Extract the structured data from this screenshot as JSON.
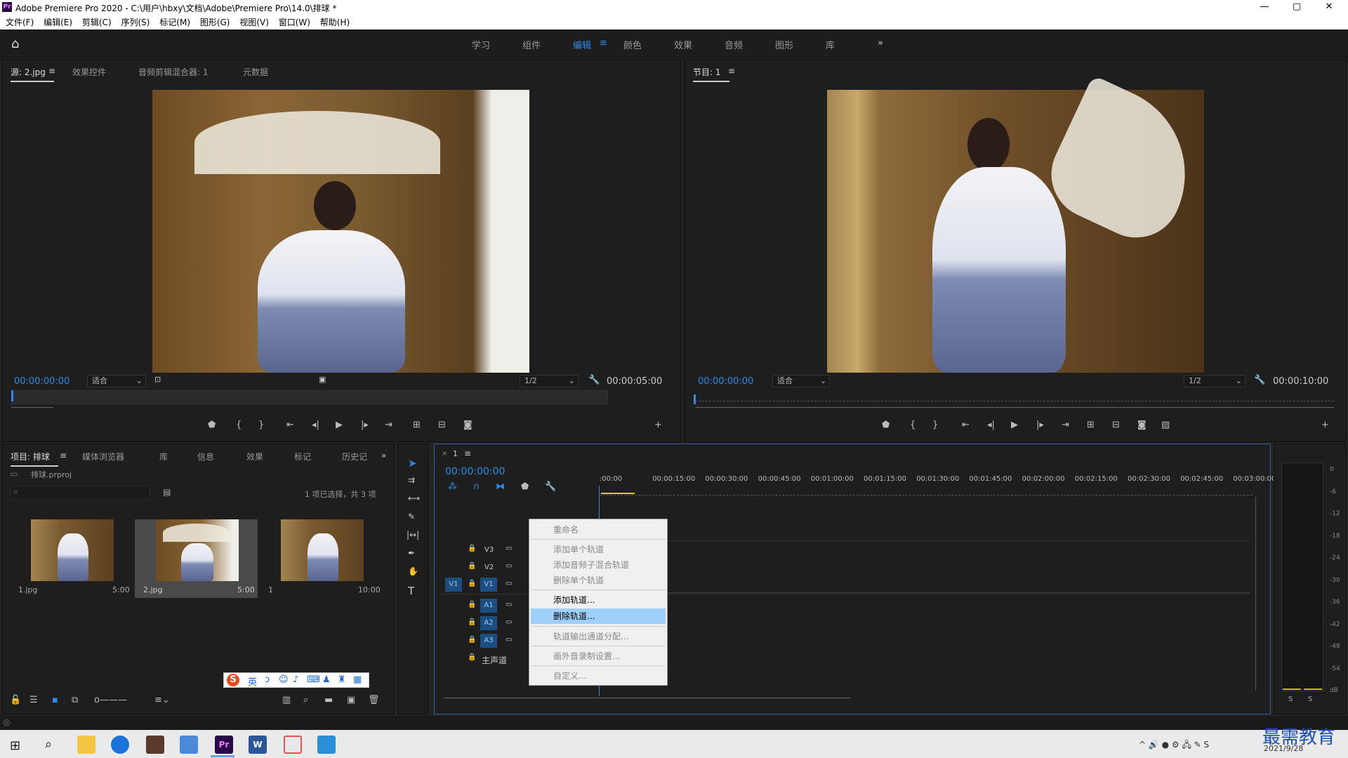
{
  "titlebar": {
    "title": "Adobe Premiere Pro 2020 - C:\\用户\\hbxy\\文档\\Adobe\\Premiere Pro\\14.0\\排球 *",
    "logo": "Pr",
    "minimize": "—",
    "maximize": "▢",
    "close": "✕"
  },
  "menu": [
    "文件(F)",
    "编辑(E)",
    "剪辑(C)",
    "序列(S)",
    "标记(M)",
    "图形(G)",
    "视图(V)",
    "窗口(W)",
    "帮助(H)"
  ],
  "workspaces": [
    "学习",
    "组件",
    "编辑",
    "颜色",
    "效果",
    "音频",
    "图形",
    "库"
  ],
  "workspace_active": "编辑",
  "workspace_more": "»",
  "source": {
    "tabs": [
      "源: 2.jpg",
      "效果控件",
      "音频剪辑混合器: 1",
      "元数据"
    ],
    "timecode": "00:00:00:00",
    "fit": "适合",
    "resolution": "1/2",
    "duration": "00:00:05:00"
  },
  "program": {
    "tab": "节目: 1",
    "timecode": "00:00:00:00",
    "fit": "适合",
    "resolution": "1/2",
    "duration": "00:00:10:00"
  },
  "project": {
    "tabs": [
      "项目: 排球",
      "媒体浏览器",
      "库",
      "信息",
      "效果",
      "标记",
      "历史记"
    ],
    "file": "排球.prproj",
    "status": "1 项已选择，共 3 项",
    "items": [
      {
        "name": "1.jpg",
        "duration": "5:00"
      },
      {
        "name": "2.jpg",
        "duration": "5:00"
      },
      {
        "name": "1",
        "duration": "10:00"
      }
    ]
  },
  "ime": {
    "logo": "S",
    "lang": "英"
  },
  "timeline": {
    "tab": "1",
    "timecode": "00:00:00:00",
    "ruler": [
      ":00:00",
      "00:00:15:00",
      "00:00:30:00",
      "00:00:45:00",
      "00:01:00:00",
      "00:01:15:00",
      "00:01:30:00",
      "00:01:45:00",
      "00:02:00:00",
      "00:02:15:00",
      "00:02:30:00",
      "00:02:45:00",
      "00:03:00:00"
    ],
    "video_tracks": [
      "V3",
      "V2",
      "V1"
    ],
    "audio_tracks": [
      "A1",
      "A2",
      "A3"
    ],
    "source_patch": "V1",
    "master": "主声道"
  },
  "context_menu": {
    "items": [
      "重命名",
      "添加单个轨道",
      "添加音频子混合轨道",
      "删除单个轨道",
      "添加轨道...",
      "删除轨道...",
      "轨道输出通道分配...",
      "画外音录制设置...",
      "自定义..."
    ],
    "highlighted": "删除轨道..."
  },
  "meter": {
    "labels": [
      "0",
      "-6",
      "-12",
      "-18",
      "-24",
      "-30",
      "-36",
      "-42",
      "-48",
      "-54",
      "dB"
    ],
    "solo": [
      "S",
      "S"
    ]
  },
  "taskbar": {
    "time": "",
    "date": "2021/9/28",
    "watermark": "最需教育"
  },
  "colors": {
    "accent": "#2d8ceb",
    "menu_highlight": "#9fd0fb",
    "track_blue": "#1d4e82"
  }
}
